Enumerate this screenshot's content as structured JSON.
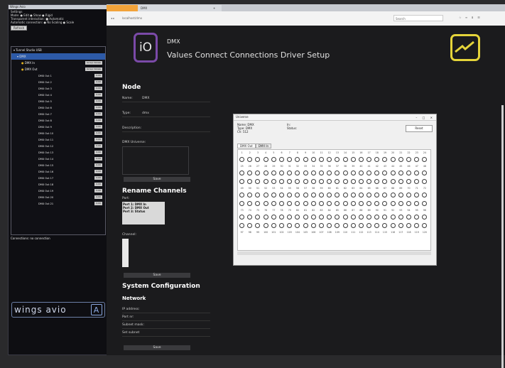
{
  "left_panel": {
    "title": "Wings Avio",
    "options": [
      "Settings",
      "Mode:  ● Edit  ● Show  ● Rigid",
      "Transparent interaction: ■ Automatic",
      "Automatic connection: ● No Scaling ● Scale"
    ],
    "refresh_label": "Refresh",
    "tree_root": "Tunnel Studio USB",
    "tree_selected": "DMX",
    "tree_groups": [
      {
        "label": "DMX In",
        "badge": "Group Values"
      },
      {
        "label": "DMX Out",
        "badge": "Group Values"
      }
    ],
    "dmx_outs": [
      "DMX Out 1",
      "DMX Out 2",
      "DMX Out 3",
      "DMX Out 4",
      "DMX Out 5",
      "DMX Out 6",
      "DMX Out 7",
      "DMX Out 8",
      "DMX Out 9",
      "DMX Out 10",
      "DMX Out 11",
      "DMX Out 12",
      "DMX Out 13",
      "DMX Out 14",
      "DMX Out 15",
      "DMX Out 16",
      "DMX Out 17",
      "DMX Out 18",
      "DMX Out 19",
      "DMX Out 20",
      "DMX Out 21"
    ],
    "out_badge": "0.00",
    "connections_label": "Connections:  no connection",
    "logo_text": "wings avio",
    "logo_letter": "A"
  },
  "browser": {
    "active_tab": "",
    "other_tab": "DMX",
    "new_tab": "+",
    "url": "localhost/dmx",
    "search_placeholder": "Search",
    "nav_buttons": "◂ ▸",
    "toolbar_icons": "☆ ≡ ⬇ ☰"
  },
  "header": {
    "icon_text": "iO",
    "device": "DMX",
    "nav": "Values  Connect  Connections  Driver  Setup"
  },
  "node": {
    "heading": "Node",
    "name_label": "Name:",
    "name_value": "DMX",
    "type_label": "Type:",
    "type_value": "dmx",
    "description_label": "Description:",
    "dmx_universe_label": "DMX Universe:",
    "save": "Save"
  },
  "rename": {
    "heading": "Rename Channels",
    "port_label": "Port:",
    "ports": [
      "Port 1: DMX In",
      "Port 2: DMX Out",
      "Port 3: Status"
    ],
    "channel_label": "Channel:",
    "save": "Save"
  },
  "system": {
    "heading": "System Configuration",
    "network_heading": "Network",
    "fields": [
      "IP address:",
      "Port nr:",
      "Subnet mask:",
      "Set subnet"
    ],
    "save": "Save"
  },
  "dialog": {
    "title": "Universe",
    "info_left": [
      "Name:  DMX",
      "Type:  DMX",
      "Ch:  512"
    ],
    "info_right": [
      "In:",
      "Status:"
    ],
    "reset": "Reset",
    "tabs": [
      "DMX Out",
      "DMX In"
    ],
    "rows": [
      {
        "header": [
          "1",
          "2",
          "3",
          "4",
          "5",
          "6",
          "7",
          "8",
          "9",
          "10",
          "11",
          "12",
          "13",
          "14",
          "15",
          "16",
          "17",
          "18",
          "19",
          "20",
          "21",
          "22",
          "23",
          "24"
        ],
        "numbers": [
          "25",
          "26",
          "27",
          "28",
          "29",
          "30",
          "31",
          "32",
          "33",
          "34",
          "35",
          "36",
          "37",
          "38",
          "39",
          "40",
          "41",
          "42",
          "43",
          "44",
          "45",
          "46",
          "47",
          "48"
        ]
      },
      {
        "header": [],
        "numbers": [
          "49",
          "50",
          "51",
          "52",
          "53",
          "54",
          "55",
          "56",
          "57",
          "58",
          "59",
          "60",
          "61",
          "62",
          "63",
          "64",
          "65",
          "66",
          "67",
          "68",
          "69",
          "70",
          "71",
          "72"
        ]
      },
      {
        "header": [],
        "numbers": [
          "73",
          "74",
          "75",
          "76",
          "77",
          "78",
          "79",
          "80",
          "81",
          "82",
          "83",
          "84",
          "85",
          "86",
          "87",
          "88",
          "89",
          "90",
          "91",
          "92",
          "93",
          "94",
          "95",
          "96"
        ]
      },
      {
        "header": [],
        "numbers": [
          "97",
          "98",
          "99",
          "100",
          "101",
          "102",
          "103",
          "104",
          "105",
          "106",
          "107",
          "108",
          "109",
          "110",
          "111",
          "112",
          "113",
          "114",
          "115",
          "116",
          "117",
          "118",
          "119",
          "120"
        ]
      }
    ]
  }
}
